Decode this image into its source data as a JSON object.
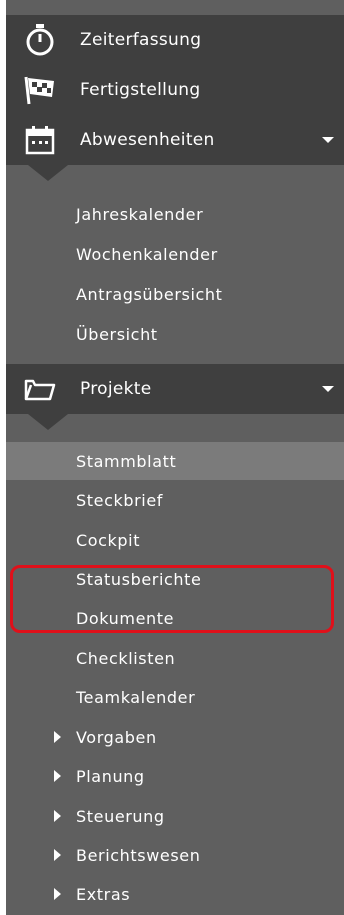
{
  "colors": {
    "nav_bg": "#5f5f5f",
    "header_bg": "#3f3f3f",
    "selected_bg": "#7b7b7b",
    "highlight": "#e0101a"
  },
  "top": [
    {
      "label": "Zeiterfassung",
      "icon": "stopwatch-icon"
    },
    {
      "label": "Fertigstellung",
      "icon": "checkered-flag-icon"
    },
    {
      "label": "Abwesenheiten",
      "icon": "calendar-icon"
    }
  ],
  "abwesenheiten_items": [
    "Jahreskalender",
    "Wochenkalender",
    "Antragsübersicht",
    "Übersicht"
  ],
  "projekte": {
    "label": "Projekte",
    "icon": "folder-icon"
  },
  "projekte_items": [
    {
      "label": "Stammblatt",
      "selected": true
    },
    {
      "label": "Steckbrief"
    },
    {
      "label": "Cockpit"
    },
    {
      "label": "Statusberichte"
    },
    {
      "label": "Dokumente"
    },
    {
      "label": "Checklisten"
    },
    {
      "label": "Teamkalender"
    },
    {
      "label": "Vorgaben",
      "expandable": true
    },
    {
      "label": "Planung",
      "expandable": true
    },
    {
      "label": "Steuerung",
      "expandable": true
    },
    {
      "label": "Berichtswesen",
      "expandable": true
    },
    {
      "label": "Extras",
      "expandable": true
    }
  ]
}
